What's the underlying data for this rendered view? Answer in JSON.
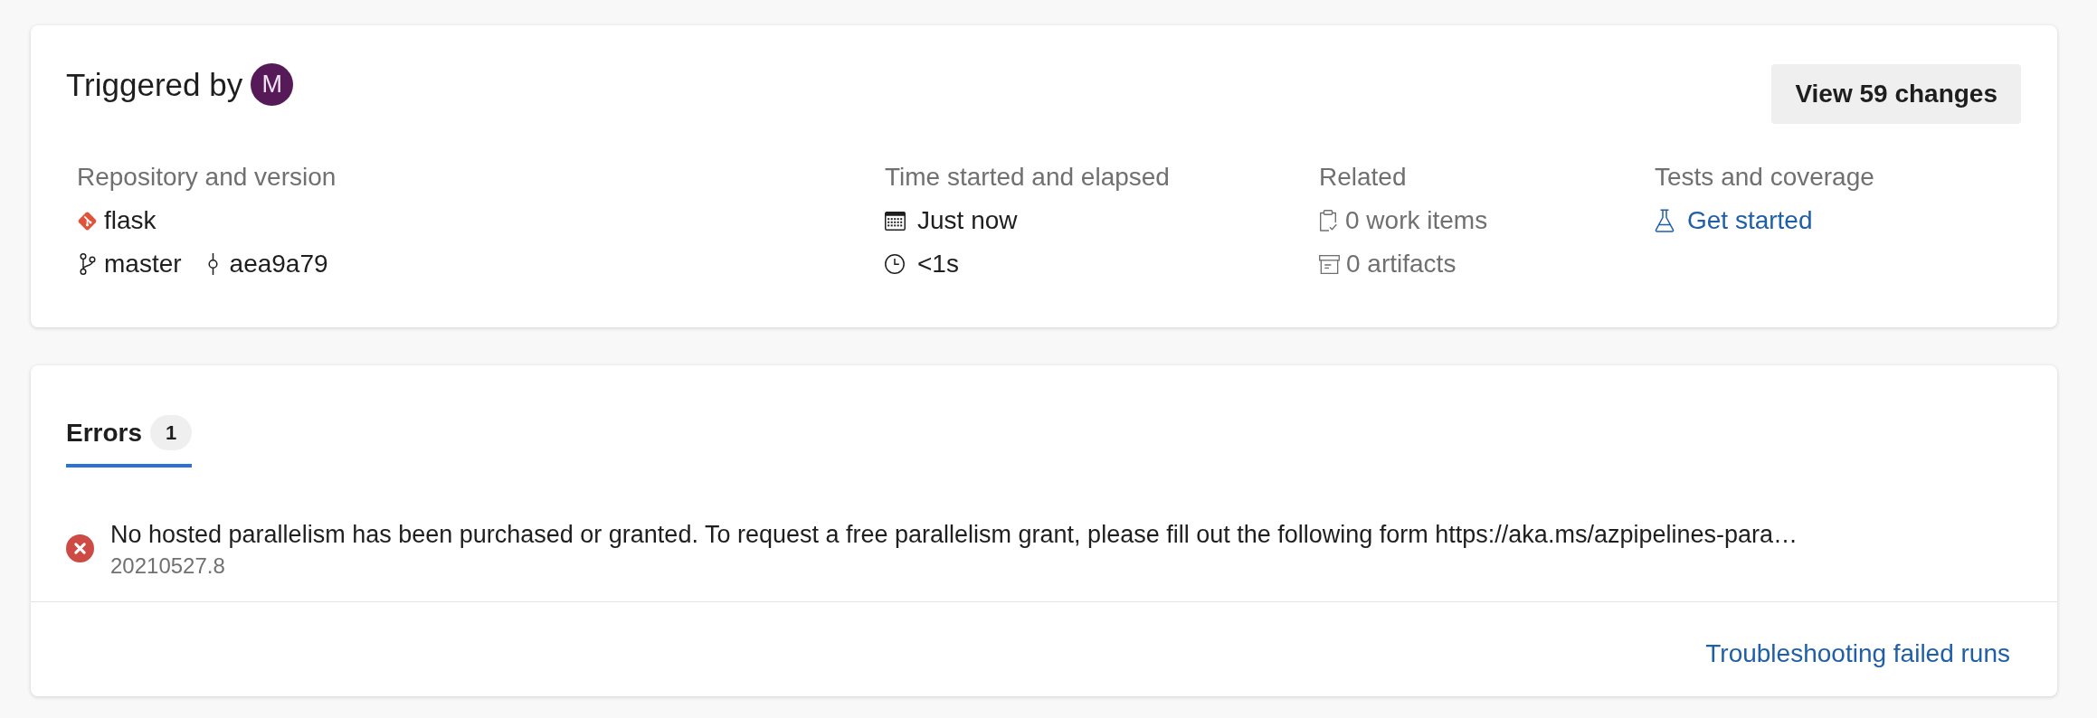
{
  "summary": {
    "title": "Triggered by",
    "avatar": {
      "initial": "M"
    },
    "changes_button": "View 59 changes",
    "sections": [
      {
        "label": "Repository and version",
        "rows": [
          [
            {
              "kind": "repository",
              "text": "flask"
            }
          ],
          [
            {
              "kind": "branch",
              "text": "master"
            },
            {
              "kind": "commit",
              "text": "aea9a79"
            }
          ]
        ]
      },
      {
        "label": "Time started and elapsed",
        "rows": [
          [
            {
              "kind": "started",
              "text": "Just now"
            }
          ],
          [
            {
              "kind": "elapsed",
              "text": "<1s"
            }
          ]
        ]
      },
      {
        "label": "Related",
        "rows": [
          [
            {
              "kind": "work_items",
              "text": "0 work items"
            }
          ],
          [
            {
              "kind": "artifacts",
              "text": "0 artifacts"
            }
          ]
        ]
      },
      {
        "label": "Tests and coverage",
        "rows": [
          [
            {
              "kind": "tests_link",
              "text": "Get started"
            }
          ]
        ]
      }
    ]
  },
  "issues": {
    "tabs": [
      {
        "label": "Errors",
        "count": "1",
        "selected": true
      }
    ],
    "items": [
      {
        "kind": "error",
        "message": "No hosted parallelism has been purchased or granted. To request a free parallelism grant, please fill out the following form https://aka.ms/azpipelines-para…",
        "run": "20210527.8"
      }
    ],
    "footer_link": "Troubleshooting failed runs"
  }
}
